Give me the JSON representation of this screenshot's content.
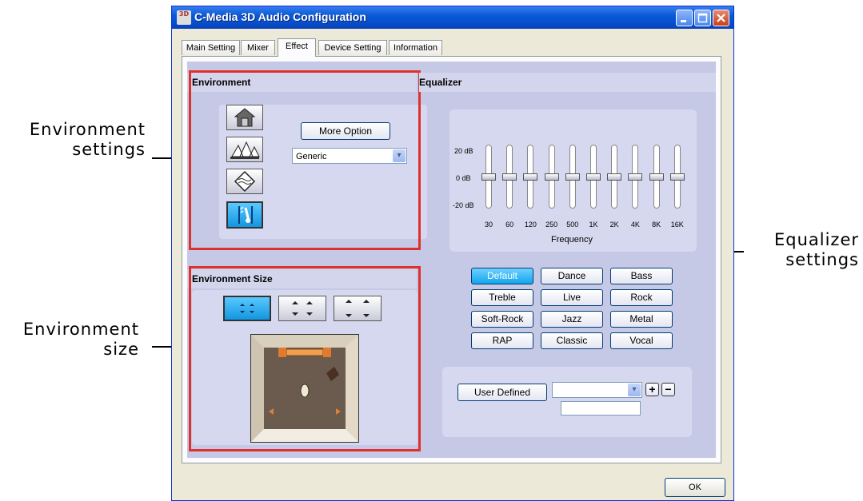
{
  "callouts": {
    "environment_settings": [
      "Environment",
      "settings"
    ],
    "environment_size": [
      "Environment",
      "size"
    ],
    "equalizer_settings": [
      "Equalizer",
      "settings"
    ]
  },
  "window": {
    "title": "C-Media 3D Audio Configuration",
    "logo_text": "3D",
    "controls": {
      "minimize": "minimize-icon",
      "maximize": "maximize-icon",
      "close": "close-icon"
    }
  },
  "tabs": [
    {
      "label": "Main Setting",
      "active": false
    },
    {
      "label": "Mixer",
      "active": false
    },
    {
      "label": "Effect",
      "active": true
    },
    {
      "label": "Device Setting",
      "active": false
    },
    {
      "label": "Information",
      "active": false
    }
  ],
  "environment": {
    "header": "Environment",
    "more_option_label": "More Option",
    "preset_value": "Generic",
    "icons": [
      "house-icon",
      "opera-house-icon",
      "underwater-icon",
      "guitar-icon"
    ],
    "selected_icon": "guitar-icon"
  },
  "environment_size": {
    "header": "Environment Size",
    "size_icons": [
      "small-room-icon",
      "medium-room-icon",
      "large-room-icon"
    ],
    "selected": "small-room-icon",
    "preview": "room-preview"
  },
  "equalizer": {
    "header": "Equalizer",
    "db_labels": [
      "20 dB",
      "0  dB",
      "-20 dB"
    ],
    "bands": [
      "30",
      "60",
      "120",
      "250",
      "500",
      "1K",
      "2K",
      "4K",
      "8K",
      "16K"
    ],
    "band_gains_db": [
      0,
      0,
      0,
      0,
      0,
      0,
      0,
      0,
      0,
      0
    ],
    "frequency_label": "Frequency",
    "presets": [
      "Default",
      "Dance",
      "Bass",
      "Treble",
      "Live",
      "Rock",
      "Soft-Rock",
      "Jazz",
      "Metal",
      "RAP",
      "Classic",
      "Vocal"
    ],
    "selected_preset": "Default",
    "user_defined_label": "User  Defined",
    "user_select_value": "",
    "user_name_value": "",
    "add_symbol": "+",
    "remove_symbol": "−"
  },
  "ok_label": "OK",
  "colors": {
    "highlight_box": "#e0302c",
    "selected_button": "#11a6ee",
    "title_bar": "#0650cf"
  }
}
